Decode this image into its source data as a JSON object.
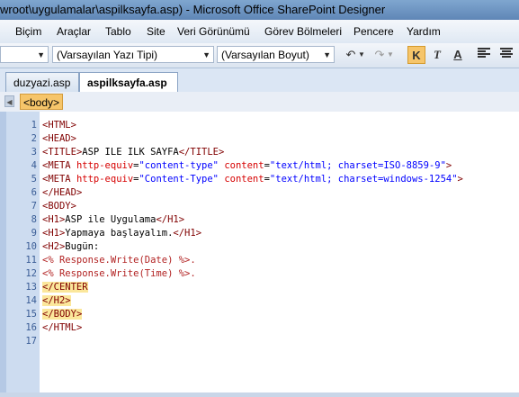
{
  "window": {
    "title": "wroot\\uygulamalar\\aspilksayfa.asp) - Microsoft Office SharePoint Designer"
  },
  "menu": [
    "Biçim",
    "Araçlar",
    "Tablo",
    "Site",
    "Veri Görünümü",
    "Görev Bölmeleri",
    "Pencere",
    "Yardım"
  ],
  "toolbar": {
    "style_value": "",
    "font_value": "(Varsayılan Yazı Tipi)",
    "size_value": "(Varsayılan Boyut)",
    "bold_label": "K",
    "italic_label": "T",
    "underline_label": "A"
  },
  "tabs": [
    "duzyazi.asp",
    "aspilksayfa.asp"
  ],
  "tagbar": {
    "tag": "<body>"
  },
  "editor": {
    "line_numbers": [
      "1",
      "2",
      "3",
      "4",
      "5",
      "6",
      "7",
      "8",
      "9",
      "10",
      "11",
      "12",
      "13",
      "14",
      "15",
      "16",
      "17"
    ],
    "lines": [
      "<HTML>",
      "<HEAD>",
      "<TITLE>ASP ILE ILK SAYFA</TITLE>",
      "<META http-equiv=\"content-type\" content=\"text/html; charset=ISO-8859-9\">",
      "<META http-equiv=\"Content-Type\" content=\"text/html; charset=windows-1254\">",
      "</HEAD>",
      "<BODY>",
      "<H1>ASP ile Uygulama</H1>",
      "<H1>Yapmaya başlayalım.</H1>",
      "<H2>Bugün:",
      "<% Response.Write(Date) %>.",
      "<% Response.Write(Time) %>.",
      "</CENTER",
      "</H2>",
      "</BODY>",
      "</HTML>",
      ""
    ]
  },
  "colors": {
    "tag": "#800000",
    "attr": "#d60000",
    "value": "#0000ff",
    "highlight": "#fbe79b"
  }
}
